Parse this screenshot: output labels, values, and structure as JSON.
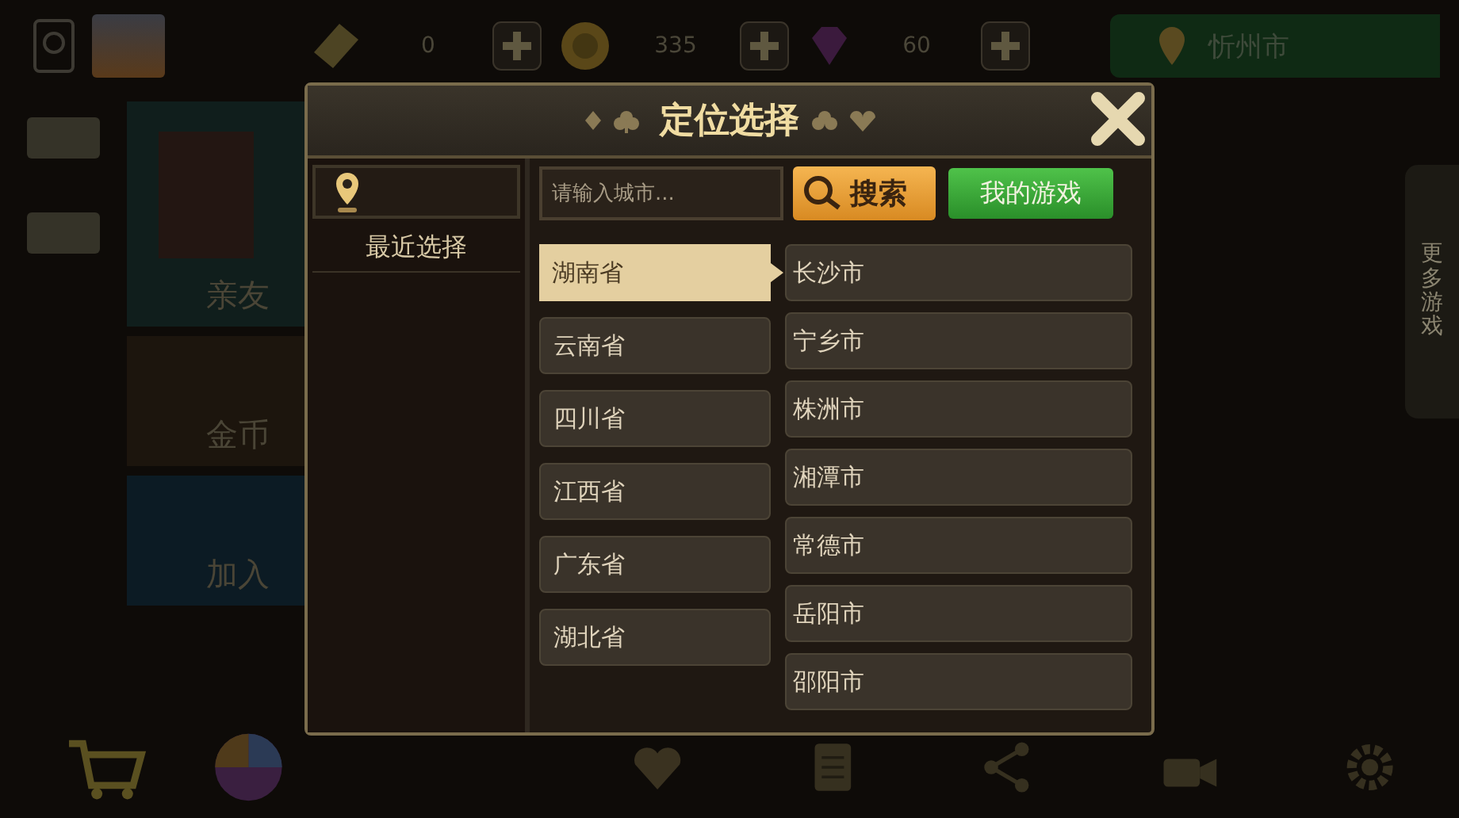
{
  "top_bar": {
    "diamond_count": "0",
    "coin_count": "335",
    "gem_count": "60",
    "location": "忻州市"
  },
  "side_cards": [
    {
      "label": "亲友"
    },
    {
      "label": "金币"
    },
    {
      "label": "加入"
    }
  ],
  "more_games": "更多游戏",
  "dialog": {
    "title": "定位选择",
    "recent_label": "最近选择",
    "search": {
      "placeholder": "请输入城市...",
      "button": "搜索"
    },
    "my_games_button": "我的游戏",
    "provinces": [
      {
        "name": "湖南省",
        "selected": true
      },
      {
        "name": "云南省",
        "selected": false
      },
      {
        "name": "四川省",
        "selected": false
      },
      {
        "name": "江西省",
        "selected": false
      },
      {
        "name": "广东省",
        "selected": false
      },
      {
        "name": "湖北省",
        "selected": false
      }
    ],
    "cities": [
      "长沙市",
      "宁乡市",
      "株洲市",
      "湘潭市",
      "常德市",
      "岳阳市",
      "邵阳市"
    ]
  }
}
